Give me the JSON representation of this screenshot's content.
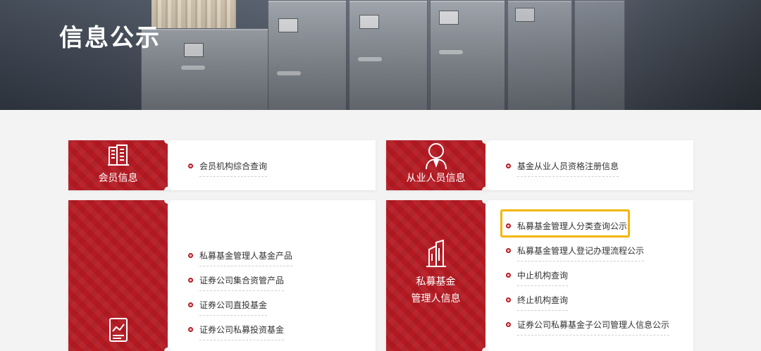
{
  "header": {
    "title": "信息公示"
  },
  "colors": {
    "accent_red": "#b51a23",
    "highlight": "#f2b705"
  },
  "cards": {
    "member": {
      "label": "会员信息",
      "icon": "building-icon",
      "links": [
        {
          "text": "会员机构综合查询"
        }
      ]
    },
    "practitioner": {
      "label": "从业人员信息",
      "icon": "person-icon",
      "links": [
        {
          "text": "基金从业人员资格注册信息"
        }
      ]
    },
    "products": {
      "label": "",
      "icon": "report-icon",
      "links": [
        {
          "text": "私募基金管理人基金产品"
        },
        {
          "text": "证券公司集合资管产品"
        },
        {
          "text": "证券公司直投基金"
        },
        {
          "text": "证券公司私募投资基金"
        }
      ]
    },
    "manager": {
      "label_line1": "私募基金",
      "label_line2": "管理人信息",
      "icon": "office-icon",
      "links": [
        {
          "text": "私募基金管理人分类查询公示",
          "highlighted": true
        },
        {
          "text": "私募基金管理人登记办理流程公示"
        },
        {
          "text": "中止机构查询"
        },
        {
          "text": "终止机构查询"
        },
        {
          "text": "证券公司私募基金子公司管理人信息公示"
        }
      ]
    }
  }
}
